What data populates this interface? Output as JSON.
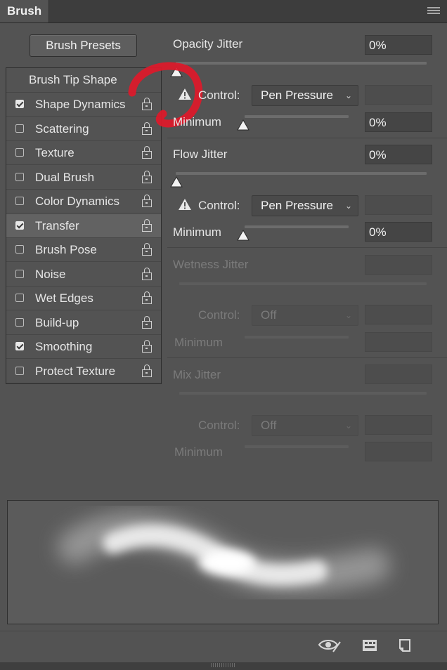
{
  "panel": {
    "tab_title": "Brush"
  },
  "presets_button": "Brush Presets",
  "tip_shape": "Brush Tip Shape",
  "list": [
    {
      "label": "Shape Dynamics",
      "checked": true,
      "selected": false
    },
    {
      "label": "Scattering",
      "checked": false,
      "selected": false
    },
    {
      "label": "Texture",
      "checked": false,
      "selected": false
    },
    {
      "label": "Dual Brush",
      "checked": false,
      "selected": false
    },
    {
      "label": "Color Dynamics",
      "checked": false,
      "selected": false
    },
    {
      "label": "Transfer",
      "checked": true,
      "selected": true
    },
    {
      "label": "Brush Pose",
      "checked": false,
      "selected": false
    },
    {
      "label": "Noise",
      "checked": false,
      "selected": false
    },
    {
      "label": "Wet Edges",
      "checked": false,
      "selected": false
    },
    {
      "label": "Build-up",
      "checked": false,
      "selected": false
    },
    {
      "label": "Smoothing",
      "checked": true,
      "selected": false
    },
    {
      "label": "Protect Texture",
      "checked": false,
      "selected": false
    }
  ],
  "opacity": {
    "label": "Opacity Jitter",
    "value": "0%",
    "control_label": "Control:",
    "control_value": "Pen Pressure",
    "min_label": "Minimum",
    "min_value": "0%"
  },
  "flow": {
    "label": "Flow Jitter",
    "value": "0%",
    "control_label": "Control:",
    "control_value": "Pen Pressure",
    "min_label": "Minimum",
    "min_value": "0%"
  },
  "wetness": {
    "label": "Wetness Jitter",
    "control_label": "Control:",
    "control_value": "Off",
    "min_label": "Minimum"
  },
  "mix": {
    "label": "Mix Jitter",
    "control_label": "Control:",
    "control_value": "Off",
    "min_label": "Minimum"
  },
  "icons": {
    "menu": "panel-menu-icon",
    "eye": "toggle-live-tip-preview-icon",
    "grid": "brush-projection-icon",
    "new": "create-new-brush-icon",
    "warning": "warning-icon",
    "lock": "lock-icon"
  },
  "colors": {
    "annotation": "#e0192a",
    "panel": "#535353",
    "selected_row": "#626262"
  }
}
